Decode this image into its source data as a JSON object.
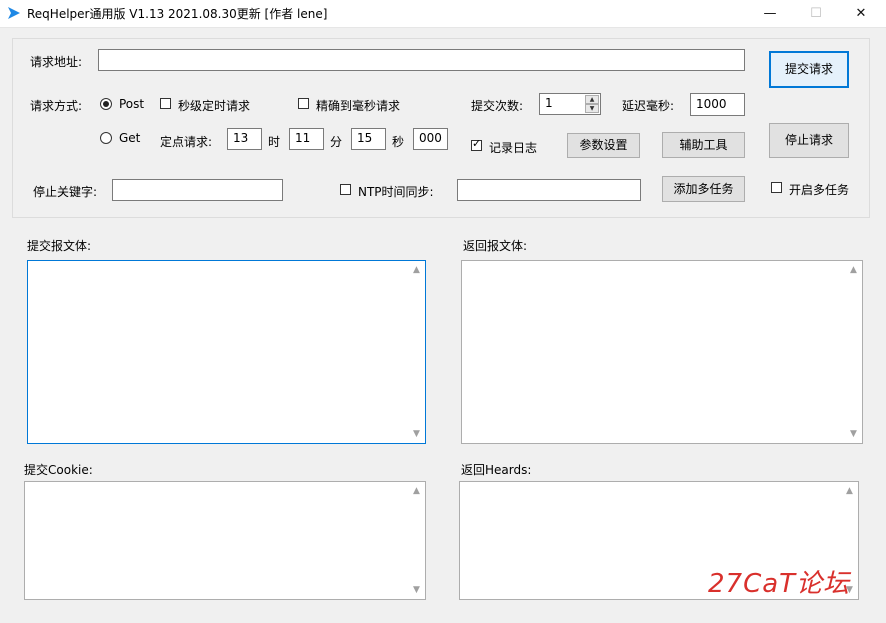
{
  "window": {
    "title": "ReqHelper通用版 V1.13  2021.08.30更新  [作者 lene]",
    "minimize": "—",
    "maximize": "☐",
    "close": "✕"
  },
  "request": {
    "url_label": "请求地址:",
    "url_value": "",
    "method_label": "请求方式:",
    "post_label": "Post",
    "get_label": "Get",
    "selected_method": "Post",
    "sec_timer_label": "秒级定时请求",
    "ms_precise_label": "精确到毫秒请求",
    "submit_count_label": "提交次数:",
    "submit_count": "1",
    "delay_ms_label": "延迟毫秒:",
    "delay_ms": "1000",
    "fixed_time_label": "定点请求:",
    "hour": "13",
    "hour_unit": "时",
    "minute": "11",
    "minute_unit": "分",
    "second": "15",
    "second_unit": "秒",
    "millisecond": "000",
    "log_label": "记录日志",
    "log_checked": true,
    "stop_keyword_label": "停止关键字:",
    "stop_keyword": "",
    "ntp_label": "NTP时间同步:",
    "ntp_value": "",
    "multi_task_label": "开启多任务"
  },
  "buttons": {
    "submit": "提交请求",
    "stop": "停止请求",
    "params": "参数设置",
    "tools": "辅助工具",
    "add_tasks": "添加多任务"
  },
  "sections": {
    "submit_body": "提交报文体:",
    "return_body": "返回报文体:",
    "submit_cookie": "提交Cookie:",
    "return_headers": "返回Heards:"
  },
  "watermark": "27CaT论坛",
  "colors": {
    "accent": "#0078d7",
    "watermark": "#d9302c"
  }
}
